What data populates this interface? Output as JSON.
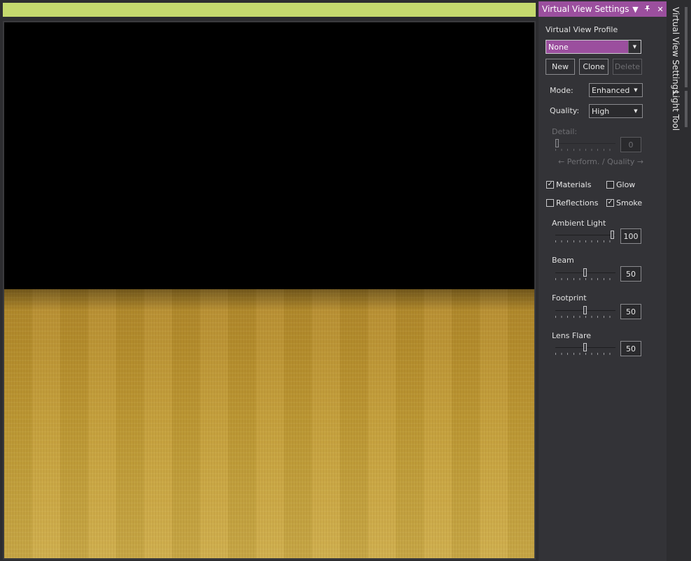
{
  "panel": {
    "title": "Virtual View Settings",
    "profile_label": "Virtual View Profile",
    "profile_value": "None",
    "buttons": {
      "new": "New",
      "clone": "Clone",
      "delete": "Delete"
    },
    "mode_label": "Mode:",
    "mode_value": "Enhanced",
    "quality_label": "Quality:",
    "quality_value": "High",
    "detail_label": "Detail:",
    "detail_value": "0",
    "perf_quality_label": "← Perform. / Quality →",
    "checks": {
      "materials": {
        "label": "Materials",
        "checked": true
      },
      "glow": {
        "label": "Glow",
        "checked": false
      },
      "reflections": {
        "label": "Reflections",
        "checked": false
      },
      "smoke": {
        "label": "Smoke",
        "checked": true
      }
    },
    "sliders": {
      "ambient": {
        "label": "Ambient Light",
        "value": "100"
      },
      "beam": {
        "label": "Beam",
        "value": "50"
      },
      "footprint": {
        "label": "Footprint",
        "value": "50"
      },
      "lensflare": {
        "label": "Lens Flare",
        "value": "50"
      }
    }
  },
  "tabs": {
    "virtual_view": "Virtual View Settings",
    "light_tool": "Light Tool"
  },
  "colors": {
    "accent": "#9b4f9e",
    "viewport_title": "#c5d96e",
    "floor": "#c29c35"
  },
  "icons": {
    "dropdown": "triangle-down",
    "pin": "pin",
    "close": "x"
  }
}
